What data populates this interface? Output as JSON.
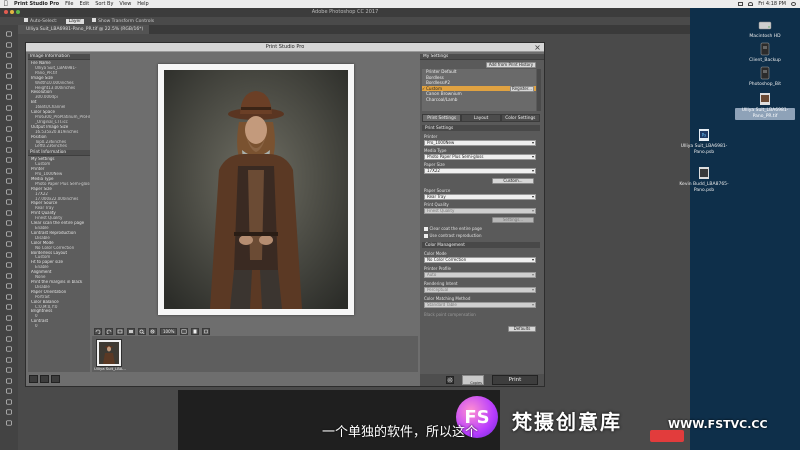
{
  "menubar": {
    "app_name": "Print Studio Pro",
    "items": [
      "File",
      "Edit",
      "Sort By",
      "View",
      "Help"
    ],
    "clock": "Fri 4:18 PM"
  },
  "photoshop": {
    "title": "Adobe Photoshop CC 2017",
    "options": [
      "Auto-Select:",
      "Layer",
      "Show Transform Controls"
    ],
    "doc_tab": "Ulliya Suit_LBA6981-Pano_PR.tif @ 22.5% (RGB/16*)"
  },
  "desktop": {
    "icons": [
      {
        "label": "Macintosh HD",
        "selected": false
      },
      {
        "label": "Client_Backup",
        "selected": false
      },
      {
        "label": "Photoshop_Bit",
        "selected": false
      },
      {
        "label": "Ulliya Suit_LBA6981-Pano_PR.tif",
        "selected": true
      },
      {
        "label": "Ulliya Suit_LBA6981-Pano.psb",
        "selected": false
      },
      {
        "label": "Kevin Budd_LBA8765-Pano.psb",
        "selected": false
      }
    ]
  },
  "dialog": {
    "title": "Print Studio Pro",
    "image_info_header": "Image Information",
    "image_info": [
      {
        "text": "File Name",
        "sub": false
      },
      {
        "text": "Ulliya Suit_LBA6981-",
        "sub": true
      },
      {
        "text": "Pano_PR.tif",
        "sub": true
      },
      {
        "text": "Image Size",
        "sub": false
      },
      {
        "text": "Width10.000inches",
        "sub": true
      },
      {
        "text": "Height13.000inches",
        "sub": true
      },
      {
        "text": "Resolution",
        "sub": false
      },
      {
        "text": "300.000dpi",
        "sub": true
      },
      {
        "text": "Bit",
        "sub": false
      },
      {
        "text": "16Bits/Channel",
        "sub": true
      },
      {
        "text": "Color Space",
        "sub": false
      },
      {
        "text": "Pro6300_ProPlatinum_ProFile",
        "sub": true
      },
      {
        "text": "_Original_CTI.icc",
        "sub": true
      },
      {
        "text": "Output Image Size",
        "sub": false
      },
      {
        "text": "16.535x20.819inches",
        "sub": true
      },
      {
        "text": "Position",
        "sub": false
      },
      {
        "text": "Top0.236inches",
        "sub": true
      },
      {
        "text": "Left0.236inches",
        "sub": true
      }
    ],
    "print_info_header": "Print Information",
    "print_info": [
      {
        "text": "My Settings",
        "sub": false
      },
      {
        "text": "Custom",
        "sub": true
      },
      {
        "text": "Printer",
        "sub": false
      },
      {
        "text": "Pro_1000New",
        "sub": true
      },
      {
        "text": "Media Type",
        "sub": false
      },
      {
        "text": "Photo Paper Plus Semi-gloss",
        "sub": true
      },
      {
        "text": "Paper Size",
        "sub": false
      },
      {
        "text": "17X22",
        "sub": true
      },
      {
        "text": "17.000x22.000inches",
        "sub": true
      },
      {
        "text": "Paper Source",
        "sub": false
      },
      {
        "text": "Rear Tray",
        "sub": true
      },
      {
        "text": "Print Quality",
        "sub": false
      },
      {
        "text": "Finest Quality",
        "sub": true
      },
      {
        "text": "Clear scan the entire page",
        "sub": false
      },
      {
        "text": "Enable",
        "sub": true
      },
      {
        "text": "Contrast Reproduction",
        "sub": false
      },
      {
        "text": "Disable",
        "sub": true
      },
      {
        "text": "Color Mode",
        "sub": false
      },
      {
        "text": "No Color Correction",
        "sub": true
      },
      {
        "text": "Borderless Layout",
        "sub": false
      },
      {
        "text": "Custom",
        "sub": true
      },
      {
        "text": "Fit to paper size",
        "sub": false
      },
      {
        "text": "Enable",
        "sub": true
      },
      {
        "text": "Alignment",
        "sub": false
      },
      {
        "text": "None",
        "sub": true
      },
      {
        "text": "Print the margins in black",
        "sub": false
      },
      {
        "text": "Disable",
        "sub": true
      },
      {
        "text": "Paper Orientation",
        "sub": false
      },
      {
        "text": "Portrait",
        "sub": true
      },
      {
        "text": "Color Balance",
        "sub": false
      },
      {
        "text": "C:0,M:0,Y:0",
        "sub": true
      },
      {
        "text": "Brightness",
        "sub": false
      },
      {
        "text": "0",
        "sub": true
      },
      {
        "text": "Contrast",
        "sub": false
      },
      {
        "text": "0",
        "sub": true
      }
    ],
    "preview": {
      "zoom": "100%",
      "thumbnail_label": "Ulliya Suit_LBA..."
    },
    "settings": {
      "header": "My Settings",
      "add_button": "Add from Print History",
      "presets": [
        "Printer Default",
        "Bordless",
        "Bordless#2",
        "Custom",
        "Canon Brownium",
        "Charcoal/Lamb"
      ],
      "selected_preset": "Custom",
      "register_button": "Register...",
      "tabs": [
        "Print Settings",
        "Layout",
        "Color Settings"
      ],
      "active_tab": "Print Settings",
      "print_settings_header": "Print Settings",
      "printer_label": "Printer",
      "printer_value": "Pro_1000New",
      "media_label": "Media Type",
      "media_value": "Photo Paper Plus Semi-gloss",
      "paper_size_label": "Paper Size",
      "paper_size_value": "17X22",
      "custom_button": "Custom...",
      "paper_source_label": "Paper Source",
      "paper_source_value": "Rear Tray",
      "print_quality_label": "Print Quality",
      "print_quality_value": "Finest Quality",
      "settings_button": "Settings...",
      "clear_coat": "Clear coat the entire page",
      "contrast_repro": "Use contrast reproduction",
      "color_mgmt_header": "Color Management",
      "color_mode_label": "Color Mode",
      "color_mode_value": "No Color Correction",
      "printer_profile_label": "Printer Profile",
      "printer_profile_value": "Auto",
      "rendering_label": "Rendering Intent",
      "rendering_value": "Perceptual",
      "matching_label": "Color Matching Method",
      "matching_value": "Standard Table",
      "bpc_label": "Black point compensation",
      "defaults_button": "Defaults"
    },
    "copies": "Copies",
    "print_button": "Print"
  },
  "subtitle": "一个单独的软件，所以这个",
  "watermark": {
    "logo": "FS",
    "text": "梵摄创意库",
    "url": "WWW.FSTVC.CC"
  },
  "colors": {
    "accent_selection": "#e0a241",
    "desktop_bg": "#0e2f4a",
    "watermark_logo": "#b73cff"
  }
}
